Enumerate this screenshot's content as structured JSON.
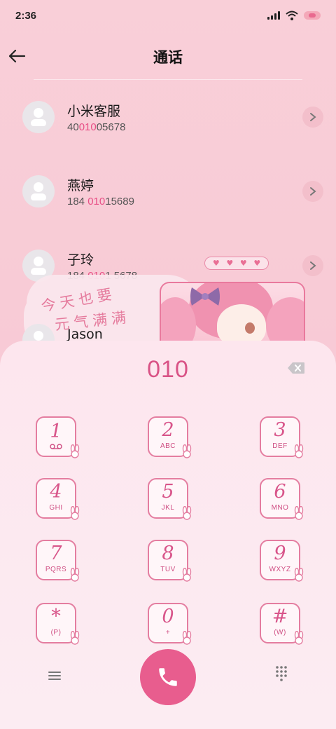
{
  "status_bar": {
    "time": "2:36"
  },
  "header": {
    "title": "通话"
  },
  "contacts": [
    {
      "name": "小米客服",
      "number_parts": [
        "40",
        "010",
        "05678"
      ]
    },
    {
      "name": "燕婷",
      "number_parts": [
        "184 ",
        "010",
        "15689"
      ]
    },
    {
      "name": "子玲",
      "number_parts": [
        "184 ",
        "010",
        "1 5678"
      ]
    },
    {
      "name": "Jason",
      "number_parts": [
        "",
        "",
        ""
      ]
    }
  ],
  "decoration": {
    "line1": "今天也要",
    "line2": "元气满满"
  },
  "dialer": {
    "input": "010",
    "keys": [
      {
        "digit": "1",
        "letters": ""
      },
      {
        "digit": "2",
        "letters": "ABC"
      },
      {
        "digit": "3",
        "letters": "DEF"
      },
      {
        "digit": "4",
        "letters": "GHI"
      },
      {
        "digit": "5",
        "letters": "JKL"
      },
      {
        "digit": "6",
        "letters": "MNO"
      },
      {
        "digit": "7",
        "letters": "PQRS"
      },
      {
        "digit": "8",
        "letters": "TUV"
      },
      {
        "digit": "9",
        "letters": "WXYZ"
      },
      {
        "digit": "*",
        "letters": "(P)"
      },
      {
        "digit": "0",
        "letters": "+"
      },
      {
        "digit": "#",
        "letters": "(W)"
      }
    ]
  },
  "icons": {
    "back": "arrow-left-icon",
    "voicemail": "voicemail-icon",
    "backspace": "backspace-icon",
    "call": "phone-icon",
    "menu": "menu-icon",
    "keypad": "keypad-icon"
  },
  "colors": {
    "accent": "#e85d8e",
    "highlight": "#e84f86",
    "background": "#f9cfd8"
  }
}
